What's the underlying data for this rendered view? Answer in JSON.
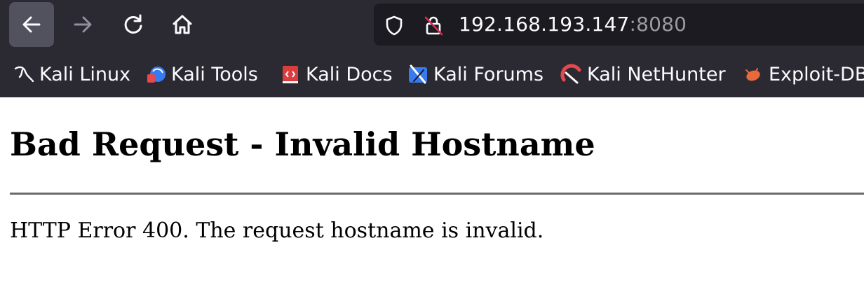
{
  "browser": {
    "url_host": "192.168.193.147",
    "url_port": ":8080",
    "bookmarks": [
      {
        "label": "Kali Linux"
      },
      {
        "label": "Kali Tools"
      },
      {
        "label": "Kali Docs"
      },
      {
        "label": "Kali Forums"
      },
      {
        "label": "Kali NetHunter"
      },
      {
        "label": "Exploit-DB"
      }
    ]
  },
  "page": {
    "heading": "Bad Request - Invalid Hostname",
    "message": "HTTP Error 400. The request hostname is invalid."
  }
}
